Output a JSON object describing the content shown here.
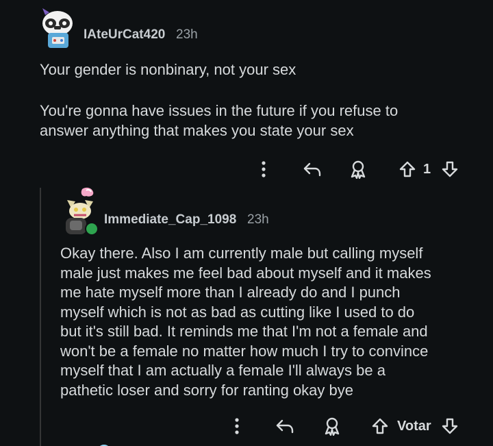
{
  "comments": [
    {
      "username": "IAteUrCat420",
      "time": "23h",
      "body": [
        "Your gender is nonbinary, not your sex",
        "",
        "You're gonna have issues in the future if you refuse to",
        "answer anything that makes you state your sex"
      ],
      "vote_count": "1",
      "avatar_icon": "panda-gamer-avatar-icon"
    },
    {
      "username": "Immediate_Cap_1098",
      "time": "23h",
      "body": [
        "Okay there. Also I am currently male but calling myself",
        "male just makes me feel bad about myself and it makes",
        "me hate myself more than I already do and I punch",
        "myself which is not as bad as cutting like I used to do",
        "but it's still bad. It reminds me that I'm not a female and",
        "won't be a female no matter how much I try to convince",
        "myself that I am actually a female I'll always be a",
        "pathetic loser and sorry for ranting okay bye"
      ],
      "vote_label": "Votar",
      "avatar_icon": "fox-animatronic-avatar-icon",
      "online_status_color": "#2ea44f"
    }
  ],
  "colors": {
    "background": "#0e1113",
    "text": "#d7dadc",
    "muted": "#9aa1a6",
    "thread_line": "#343536"
  }
}
